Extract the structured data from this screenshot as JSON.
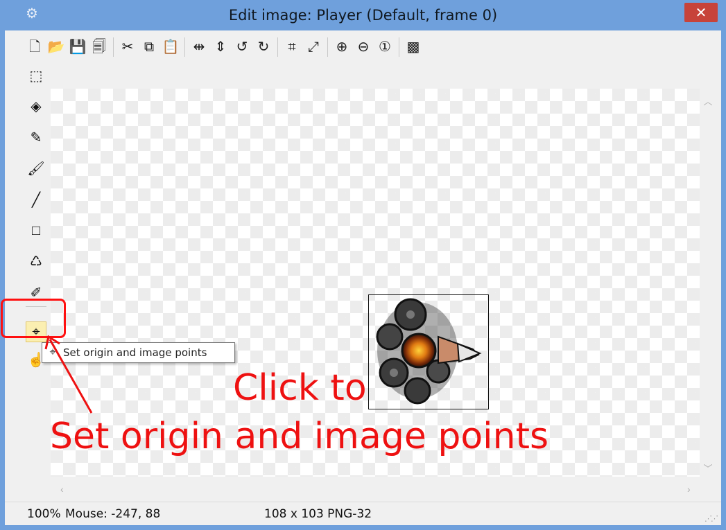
{
  "window": {
    "title": "Edit image: Player (Default, frame 0)",
    "close_glyph": "✕",
    "app_icon": "gear-icon"
  },
  "toolbar": {
    "groups": [
      [
        {
          "name": "new-icon",
          "glyph": "🗋"
        },
        {
          "name": "open-icon",
          "glyph": "📂"
        },
        {
          "name": "save-icon",
          "glyph": "💾"
        },
        {
          "name": "save-as-icon",
          "glyph": "🗐"
        }
      ],
      [
        {
          "name": "cut-icon",
          "glyph": "✂"
        },
        {
          "name": "copy-icon",
          "glyph": "⧉"
        },
        {
          "name": "paste-icon",
          "glyph": "📋"
        }
      ],
      [
        {
          "name": "flip-horizontal-icon",
          "glyph": "⇹"
        },
        {
          "name": "flip-vertical-icon",
          "glyph": "⇕"
        },
        {
          "name": "rotate-left-icon",
          "glyph": "↺"
        },
        {
          "name": "rotate-right-icon",
          "glyph": "↻"
        }
      ],
      [
        {
          "name": "crop-icon",
          "glyph": "⌗"
        },
        {
          "name": "resize-icon",
          "glyph": "⤢"
        }
      ],
      [
        {
          "name": "zoom-in-icon",
          "glyph": "⊕"
        },
        {
          "name": "zoom-out-icon",
          "glyph": "⊖"
        },
        {
          "name": "zoom-reset-icon",
          "glyph": "①"
        }
      ],
      [
        {
          "name": "transparency-icon",
          "glyph": "▩"
        }
      ]
    ]
  },
  "tools": [
    {
      "name": "select-rect-icon",
      "glyph": "⬚"
    },
    {
      "name": "eraser-icon",
      "glyph": "◈"
    },
    {
      "name": "pencil-icon",
      "glyph": "✎"
    },
    {
      "name": "brush-icon",
      "glyph": "🖌"
    },
    {
      "name": "line-icon",
      "glyph": "╱"
    },
    {
      "name": "rectangle-icon",
      "glyph": "□"
    },
    {
      "name": "fill-bucket-icon",
      "glyph": "♺"
    },
    {
      "name": "eyedropper-icon",
      "glyph": "✐"
    },
    {
      "name": "origin-point-icon",
      "glyph": "⌖"
    },
    {
      "name": "collision-polygon-icon",
      "glyph": "☝"
    }
  ],
  "tooltip": {
    "text": "Set origin and image points",
    "icon": "origin-point-icon"
  },
  "annotation": {
    "line1": "Click to",
    "line2": "Set origin and image points",
    "color": "#ee1111"
  },
  "status": {
    "zoom": "100%",
    "mouse": "Mouse: -247, 88",
    "image_info": "108 x 103  PNG-32"
  },
  "colors": {
    "titlebar": "#6fa0dc",
    "close": "#c7433a",
    "active_tool": "#fbefb1"
  }
}
